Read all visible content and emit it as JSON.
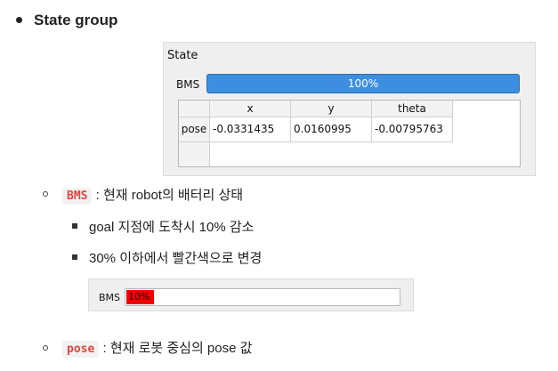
{
  "section": {
    "title": "State group"
  },
  "panel": {
    "title": "State",
    "bms_label": "BMS",
    "bms_value_text": "100%",
    "bms_value": 100,
    "table": {
      "columns": [
        "x",
        "y",
        "theta"
      ],
      "rows": [
        {
          "header": "pose",
          "cells": [
            "-0.0331435",
            "0.0160995",
            "-0.00795763"
          ]
        }
      ]
    }
  },
  "items": {
    "bms": {
      "code": "BMS",
      "desc": ": 현재 robot의 배터리 상태",
      "sub": [
        "goal 지점에 도착시 10% 감소",
        "30% 이하에서 빨간색으로 변경"
      ]
    },
    "pose": {
      "code": "pose",
      "desc": ": 현재 로봇 중심의 pose 값"
    }
  },
  "mini_widget": {
    "label": "BMS",
    "value_text": "10%",
    "value": 10,
    "fill_color": "#f20000"
  },
  "colors": {
    "progress_blue": "#3d8ee0",
    "code_red": "#e0453d",
    "low_battery_red": "#f20000"
  }
}
